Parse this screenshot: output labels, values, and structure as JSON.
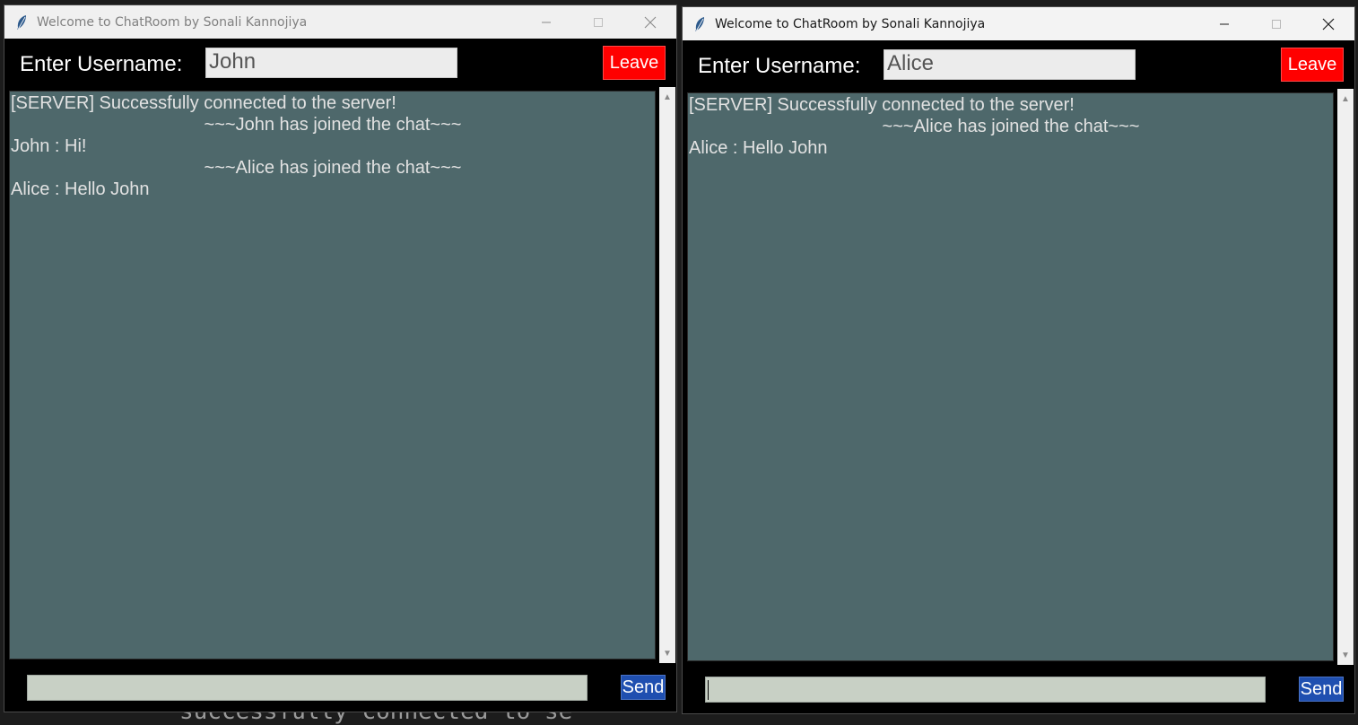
{
  "background_fragment": "successfully connected to se",
  "windows": [
    {
      "title": "Welcome to ChatRoom by Sonali Kannojiya",
      "username_label": "Enter Username:",
      "username_value": "John",
      "leave_label": "Leave",
      "send_label": "Send",
      "message_value": "",
      "messages": [
        {
          "text": "[SERVER] Successfully connected to the server!",
          "align": "left"
        },
        {
          "text": "~~~John has joined the chat~~~",
          "align": "center"
        },
        {
          "text": "John : Hi!",
          "align": "left"
        },
        {
          "text": "~~~Alice has joined the chat~~~",
          "align": "center"
        },
        {
          "text": "Alice : Hello John",
          "align": "left"
        }
      ]
    },
    {
      "title": "Welcome to ChatRoom by Sonali Kannojiya",
      "username_label": "Enter Username:",
      "username_value": "Alice",
      "leave_label": "Leave",
      "send_label": "Send",
      "message_value": "",
      "messages": [
        {
          "text": "[SERVER] Successfully connected to the server!",
          "align": "left"
        },
        {
          "text": "~~~Alice has joined the chat~~~",
          "align": "center"
        },
        {
          "text": "Alice : Hello John",
          "align": "left"
        }
      ]
    }
  ],
  "colors": {
    "leave_button": "#ff0000",
    "send_button": "#1f4fb0",
    "chat_background": "#4e686b",
    "window_background": "#000000"
  }
}
